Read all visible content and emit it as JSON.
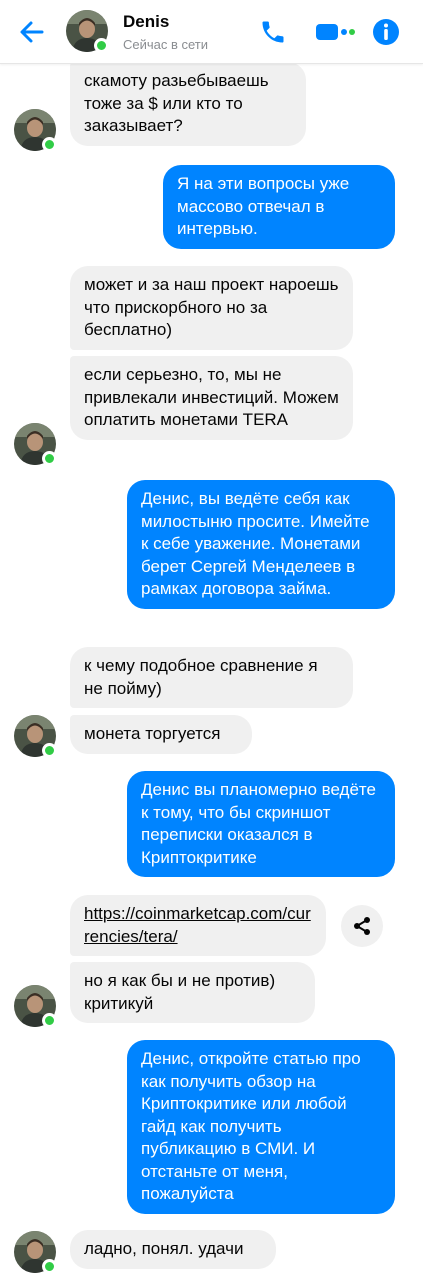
{
  "header": {
    "contact_name": "Denis",
    "status": "Сейчас в сети",
    "accent_color": "#0084ff",
    "online_color": "#31cc46"
  },
  "messages": [
    {
      "id": 1,
      "side": "incoming",
      "text": "скамоту разьебываешь тоже за $ или кто то заказывает?"
    },
    {
      "id": 2,
      "side": "outgoing",
      "text": "Я на эти вопросы уже массово отвечал в интервью."
    },
    {
      "id": 3,
      "side": "incoming",
      "text": "может и за наш проект нароешь что прискорбного но за бесплатно)"
    },
    {
      "id": 4,
      "side": "incoming",
      "text": "если серьезно, то, мы не привлекали инвестиций. Можем оплатить монетами TERA"
    },
    {
      "id": 5,
      "side": "outgoing",
      "text": "Денис, вы ведёте себя как милостыню просите. Имейте к себе уважение. Монетами берет Сергей Менделеев в рамках договора займа."
    },
    {
      "id": 6,
      "side": "incoming",
      "text": "к чему подобное сравнение я не пойму)"
    },
    {
      "id": 7,
      "side": "incoming",
      "text": "монета торгуется"
    },
    {
      "id": 8,
      "side": "outgoing",
      "text": "Денис вы планомерно ведёте к тому, что бы скриншот переписки оказался в Криптокритике"
    },
    {
      "id": 9,
      "side": "incoming",
      "text": "https://coinmarketcap.com/currencies/tera/"
    },
    {
      "id": 10,
      "side": "incoming",
      "text": "но я как бы и не против) критикуй"
    },
    {
      "id": 11,
      "side": "outgoing",
      "text": "Денис, откройте статью про как получить обзор на Криптокритике или любой гайд как получить публикацию в СМИ. И отстаньте от меня, пожалуйста"
    },
    {
      "id": 12,
      "side": "incoming",
      "text": "ладно, понял. удачи"
    }
  ],
  "icons": [
    "back-arrow-icon",
    "phone-icon",
    "video-camera-icon",
    "info-icon",
    "share-icon"
  ]
}
